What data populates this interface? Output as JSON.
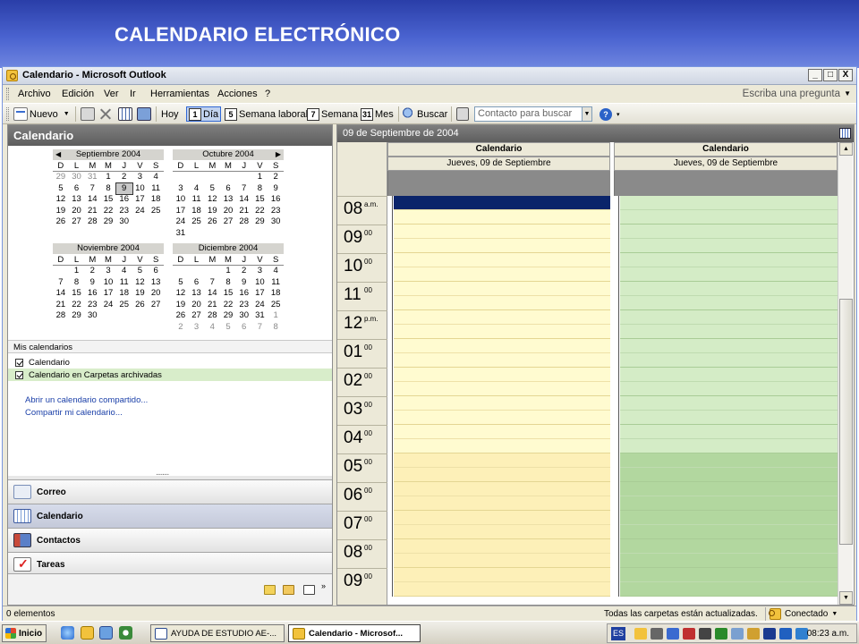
{
  "slide": {
    "title": "CALENDARIO ELECTRÓNICO"
  },
  "window": {
    "title": "Calendario - Microsoft Outlook",
    "controls": [
      "_",
      "□",
      "X"
    ]
  },
  "menu": {
    "items": [
      "Archivo",
      "Edición",
      "Ver",
      "Ir",
      "Herramientas",
      "Acciones",
      "?"
    ],
    "help_placeholder": "Escriba una pregunta"
  },
  "toolbar": {
    "new_label": "Nuevo",
    "today_label": "Hoy",
    "day_label": "Día",
    "day_num": "1",
    "workweek_label": "Semana laboral",
    "workweek_num": "5",
    "week_label": "Semana",
    "week_num": "7",
    "month_label": "Mes",
    "month_num": "31",
    "find_label": "Buscar",
    "contact_search_placeholder": "Contacto para buscar"
  },
  "nav": {
    "header": "Calendario",
    "calendars": [
      {
        "name": "Septiembre 2004",
        "dow": [
          "D",
          "L",
          "M",
          "M",
          "J",
          "V",
          "S"
        ],
        "days": [
          {
            "d": "29",
            "dim": true
          },
          {
            "d": "30",
            "dim": true
          },
          {
            "d": "31",
            "dim": true
          },
          {
            "d": "1"
          },
          {
            "d": "2"
          },
          {
            "d": "3"
          },
          {
            "d": "4"
          },
          {
            "d": "5"
          },
          {
            "d": "6"
          },
          {
            "d": "7"
          },
          {
            "d": "8"
          },
          {
            "d": "9",
            "today": true
          },
          {
            "d": "10"
          },
          {
            "d": "11"
          },
          {
            "d": "12"
          },
          {
            "d": "13"
          },
          {
            "d": "14"
          },
          {
            "d": "15"
          },
          {
            "d": "16"
          },
          {
            "d": "17"
          },
          {
            "d": "18"
          },
          {
            "d": "19"
          },
          {
            "d": "20"
          },
          {
            "d": "21"
          },
          {
            "d": "22"
          },
          {
            "d": "23"
          },
          {
            "d": "24"
          },
          {
            "d": "25"
          },
          {
            "d": "26"
          },
          {
            "d": "27"
          },
          {
            "d": "28"
          },
          {
            "d": "29"
          },
          {
            "d": "30"
          },
          {
            "d": "",
            "blank": true
          },
          {
            "d": "",
            "blank": true
          }
        ]
      },
      {
        "name": "Octubre 2004",
        "dow": [
          "D",
          "L",
          "M",
          "M",
          "J",
          "V",
          "S"
        ],
        "days": [
          {
            "d": "",
            "blank": true
          },
          {
            "d": "",
            "blank": true
          },
          {
            "d": "",
            "blank": true
          },
          {
            "d": "",
            "blank": true
          },
          {
            "d": "",
            "blank": true
          },
          {
            "d": "1"
          },
          {
            "d": "2"
          },
          {
            "d": "3"
          },
          {
            "d": "4"
          },
          {
            "d": "5"
          },
          {
            "d": "6"
          },
          {
            "d": "7"
          },
          {
            "d": "8"
          },
          {
            "d": "9"
          },
          {
            "d": "10"
          },
          {
            "d": "11"
          },
          {
            "d": "12"
          },
          {
            "d": "13"
          },
          {
            "d": "14"
          },
          {
            "d": "15"
          },
          {
            "d": "16"
          },
          {
            "d": "17"
          },
          {
            "d": "18"
          },
          {
            "d": "19"
          },
          {
            "d": "20"
          },
          {
            "d": "21"
          },
          {
            "d": "22"
          },
          {
            "d": "23"
          },
          {
            "d": "24"
          },
          {
            "d": "25"
          },
          {
            "d": "26"
          },
          {
            "d": "27"
          },
          {
            "d": "28"
          },
          {
            "d": "29"
          },
          {
            "d": "30"
          },
          {
            "d": "31"
          }
        ]
      },
      {
        "name": "Noviembre 2004",
        "dow": [
          "D",
          "L",
          "M",
          "M",
          "J",
          "V",
          "S"
        ],
        "days": [
          {
            "d": "",
            "blank": true
          },
          {
            "d": "1"
          },
          {
            "d": "2"
          },
          {
            "d": "3"
          },
          {
            "d": "4"
          },
          {
            "d": "5"
          },
          {
            "d": "6"
          },
          {
            "d": "7"
          },
          {
            "d": "8"
          },
          {
            "d": "9"
          },
          {
            "d": "10"
          },
          {
            "d": "11"
          },
          {
            "d": "12"
          },
          {
            "d": "13"
          },
          {
            "d": "14"
          },
          {
            "d": "15"
          },
          {
            "d": "16"
          },
          {
            "d": "17"
          },
          {
            "d": "18"
          },
          {
            "d": "19"
          },
          {
            "d": "20"
          },
          {
            "d": "21"
          },
          {
            "d": "22"
          },
          {
            "d": "23"
          },
          {
            "d": "24"
          },
          {
            "d": "25"
          },
          {
            "d": "26"
          },
          {
            "d": "27"
          },
          {
            "d": "28"
          },
          {
            "d": "29"
          },
          {
            "d": "30"
          }
        ]
      },
      {
        "name": "Diciembre 2004",
        "dow": [
          "D",
          "L",
          "M",
          "M",
          "J",
          "V",
          "S"
        ],
        "days": [
          {
            "d": "",
            "blank": true
          },
          {
            "d": "",
            "blank": true
          },
          {
            "d": "",
            "blank": true
          },
          {
            "d": "1"
          },
          {
            "d": "2"
          },
          {
            "d": "3"
          },
          {
            "d": "4"
          },
          {
            "d": "5"
          },
          {
            "d": "6"
          },
          {
            "d": "7"
          },
          {
            "d": "8"
          },
          {
            "d": "9"
          },
          {
            "d": "10"
          },
          {
            "d": "11"
          },
          {
            "d": "12"
          },
          {
            "d": "13"
          },
          {
            "d": "14"
          },
          {
            "d": "15"
          },
          {
            "d": "16"
          },
          {
            "d": "17"
          },
          {
            "d": "18"
          },
          {
            "d": "19"
          },
          {
            "d": "20"
          },
          {
            "d": "21"
          },
          {
            "d": "22"
          },
          {
            "d": "23"
          },
          {
            "d": "24"
          },
          {
            "d": "25"
          },
          {
            "d": "26"
          },
          {
            "d": "27"
          },
          {
            "d": "28"
          },
          {
            "d": "29"
          },
          {
            "d": "30"
          },
          {
            "d": "31"
          },
          {
            "d": "1",
            "dim": true
          },
          {
            "d": "2",
            "dim": true
          },
          {
            "d": "3",
            "dim": true
          },
          {
            "d": "4",
            "dim": true
          },
          {
            "d": "5",
            "dim": true
          },
          {
            "d": "6",
            "dim": true
          },
          {
            "d": "7",
            "dim": true
          },
          {
            "d": "8",
            "dim": true
          }
        ]
      }
    ],
    "my_calendars_title": "Mis calendarios",
    "my_calendars": [
      "Calendario",
      "Calendario en Carpetas archivadas"
    ],
    "links": [
      "Abrir un calendario compartido...",
      "Compartir mi calendario..."
    ],
    "buttons": [
      {
        "label": "Correo",
        "icon": "mail-icon",
        "color": "#e9eef6"
      },
      {
        "label": "Calendario",
        "icon": "calendar-icon",
        "color": "#7f9fd6"
      },
      {
        "label": "Contactos",
        "icon": "contacts-icon",
        "color": "#5a7fc8"
      },
      {
        "label": "Tareas",
        "icon": "tasks-icon",
        "color": "#d8d0b8"
      }
    ]
  },
  "calendar": {
    "header_date": "09 de Septiembre de 2004",
    "columns": [
      {
        "name": "Calendario",
        "date": "Jueves, 09 de Septiembre",
        "work_color": "#fffbd0",
        "off_color": "#fdf0b8"
      },
      {
        "name": "Calendario",
        "date": "Jueves, 09 de Septiembre",
        "work_color": "#d4ecc6",
        "off_color": "#b2d79f"
      }
    ],
    "times": [
      {
        "h": "08",
        "s": "a.m."
      },
      {
        "h": "09",
        "s": "00"
      },
      {
        "h": "10",
        "s": "00"
      },
      {
        "h": "11",
        "s": "00"
      },
      {
        "h": "12",
        "s": "p.m."
      },
      {
        "h": "01",
        "s": "00"
      },
      {
        "h": "02",
        "s": "00"
      },
      {
        "h": "03",
        "s": "00"
      },
      {
        "h": "04",
        "s": "00"
      },
      {
        "h": "05",
        "s": "00"
      },
      {
        "h": "06",
        "s": "00"
      },
      {
        "h": "07",
        "s": "00"
      },
      {
        "h": "08",
        "s": "00"
      },
      {
        "h": "09",
        "s": "00"
      }
    ]
  },
  "status": {
    "items": "0 elementos",
    "folders": "Todas las carpetas están actualizadas.",
    "connection": "Conectado"
  },
  "taskbar": {
    "start": "Inicio",
    "tasks": [
      "AYUDA DE ESTUDIO AE-...",
      "Calendario - Microsof..."
    ],
    "lang": "ES",
    "clock": "08:23 a.m."
  }
}
